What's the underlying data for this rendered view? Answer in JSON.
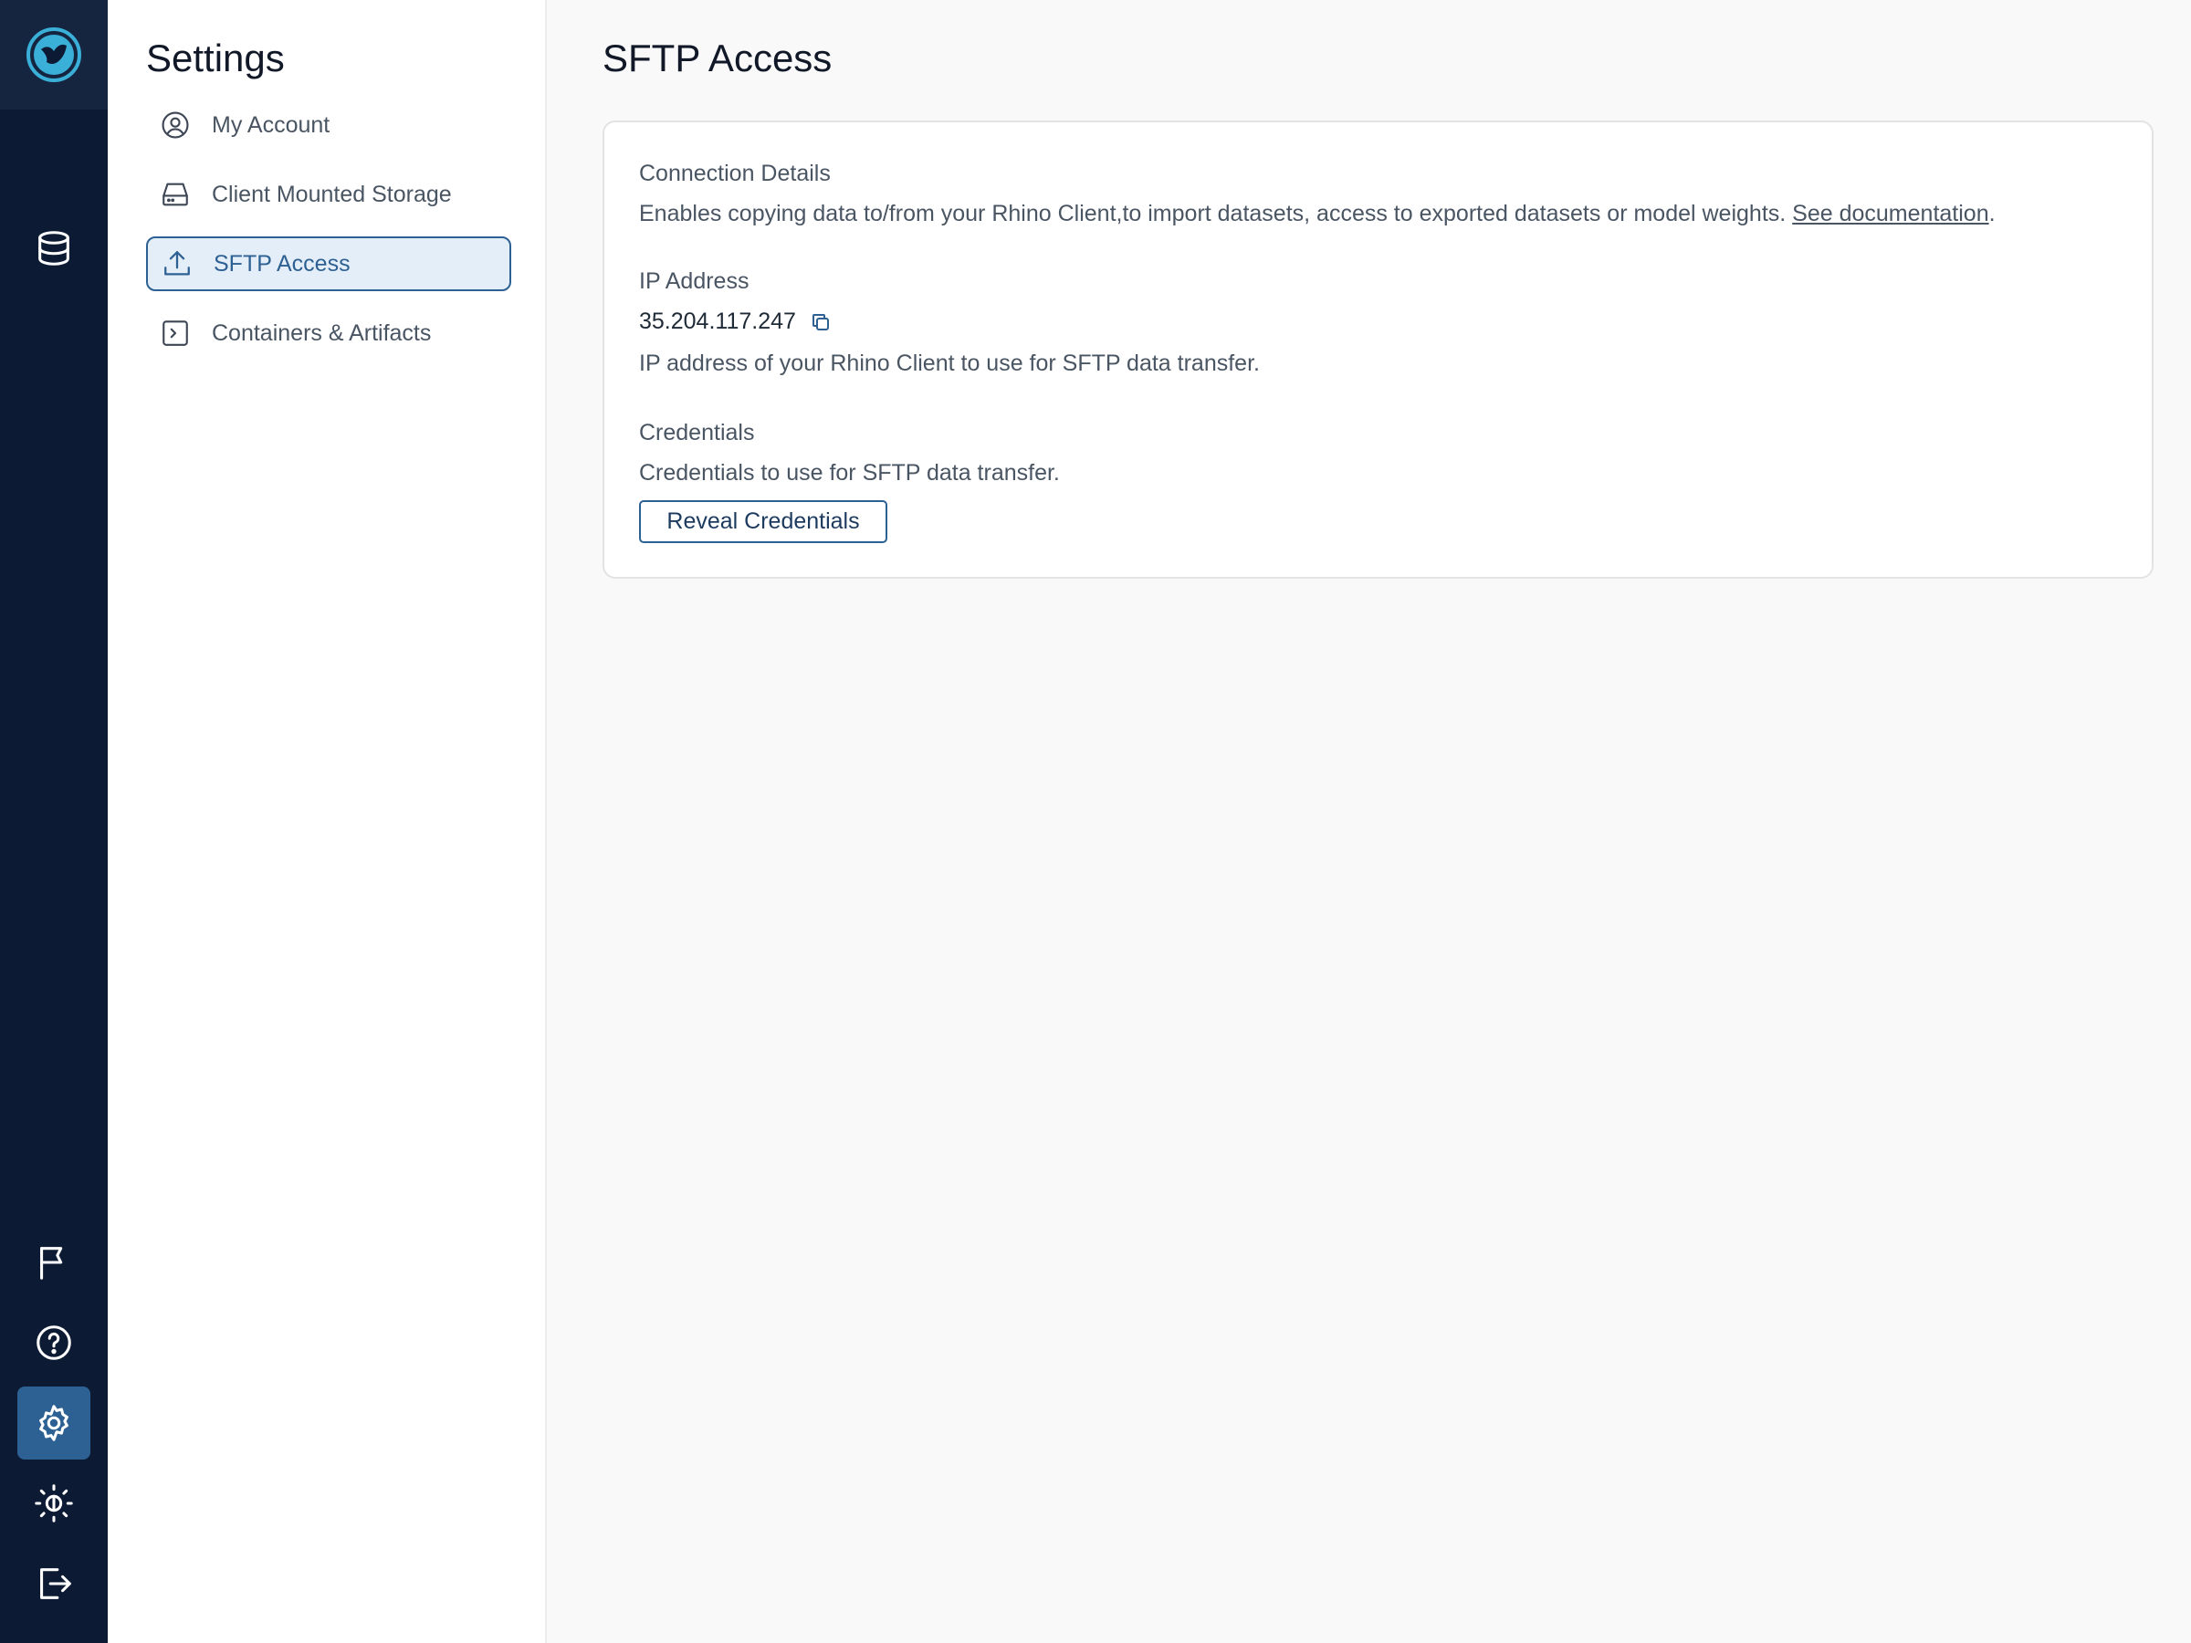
{
  "rail": {
    "logo_icon": "rhino-logo-icon",
    "top_items": [
      {
        "icon": "database-icon",
        "label": "Datasets"
      }
    ],
    "bottom_items": [
      {
        "icon": "flag-icon"
      },
      {
        "icon": "help-circle-icon"
      },
      {
        "icon": "gear-icon",
        "active": true
      },
      {
        "icon": "theme-toggle-icon"
      },
      {
        "icon": "logout-icon"
      }
    ]
  },
  "subnav": {
    "title": "Settings",
    "items": [
      {
        "label": "My Account",
        "icon": "user-circle-icon"
      },
      {
        "label": "Client Mounted Storage",
        "icon": "hard-drive-icon"
      },
      {
        "label": "SFTP Access",
        "icon": "upload-icon",
        "active": true
      },
      {
        "label": "Containers & Artifacts",
        "icon": "terminal-box-icon"
      }
    ]
  },
  "main": {
    "title": "SFTP Access",
    "connection": {
      "heading": "Connection Details",
      "description": "Enables copying data to/from your Rhino Client,to import datasets, access to exported datasets or model weights. ",
      "link_text": "See documentation",
      "suffix": "."
    },
    "ip": {
      "heading": "IP Address",
      "value": "35.204.117.247",
      "description": "IP address of your Rhino Client to use for SFTP data transfer."
    },
    "credentials": {
      "heading": "Credentials",
      "description": "Credentials to use for SFTP data transfer.",
      "button_label": "Reveal Credentials"
    }
  },
  "colors": {
    "rail_bg": "#0c1a33",
    "accent": "#2e6193",
    "active_nav_bg": "#e4eef8"
  }
}
